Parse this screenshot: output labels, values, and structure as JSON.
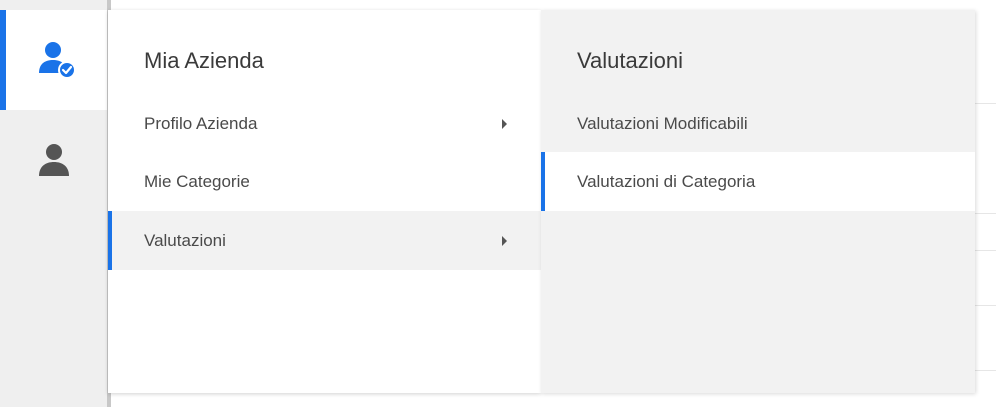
{
  "rail": {
    "items": [
      {
        "icon": "user-check-icon",
        "active": true
      },
      {
        "icon": "user-icon",
        "active": false
      }
    ]
  },
  "menu1": {
    "title": "Mia Azienda",
    "items": [
      {
        "label": "Profilo Azienda",
        "has_submenu": true
      },
      {
        "label": "Mie Categorie",
        "has_submenu": false
      },
      {
        "label": "Valutazioni",
        "has_submenu": true,
        "selected": true
      }
    ]
  },
  "menu2": {
    "title": "Valutazioni",
    "items": [
      {
        "label": "Valutazioni Modificabili"
      },
      {
        "label": "Valutazioni di Categoria",
        "selected": true
      }
    ]
  },
  "colors": {
    "accent": "#1a73e8",
    "icon_active": "#1a73e8",
    "icon_inactive": "#555555"
  }
}
